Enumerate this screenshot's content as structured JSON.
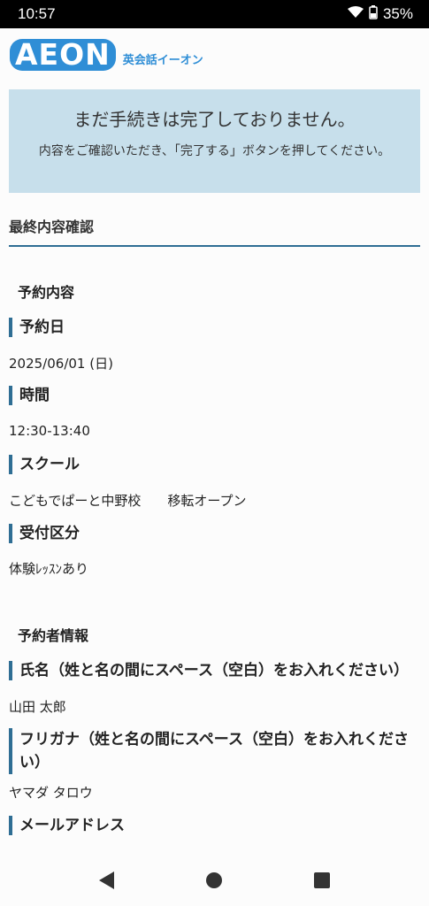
{
  "status": {
    "time": "10:57",
    "battery": "35%"
  },
  "header": {
    "logo_text": "AEON",
    "logo_sub": "英会話イーオン"
  },
  "notice": {
    "title": "まだ手続きは完了しておりません。",
    "body": "内容をご確認いただき、「完了する」ボタンを押してください。"
  },
  "section_title": "最終内容確認",
  "reservation": {
    "heading": "予約内容",
    "date_label": "予約日",
    "date_value": "2025/06/01 (日)",
    "time_label": "時間",
    "time_value": "12:30-13:40",
    "school_label": "スクール",
    "school_value": "こどもでぱーと中野校　　移転オープン",
    "type_label": "受付区分",
    "type_value": "体験ﾚｯｽﾝあり"
  },
  "reserver": {
    "heading": "予約者情報",
    "name_label": "氏名（姓と名の間にスペース（空白）をお入れください）",
    "name_value": "山田 太郎",
    "kana_label": "フリガナ（姓と名の間にスペース（空白）をお入れください）",
    "kana_value": "ヤマダ タロウ",
    "email_label": "メールアドレス"
  },
  "colors": {
    "brand": "#2f8ed6",
    "notice_bg": "#c7dfeb",
    "accent_border": "#2f6e94"
  }
}
